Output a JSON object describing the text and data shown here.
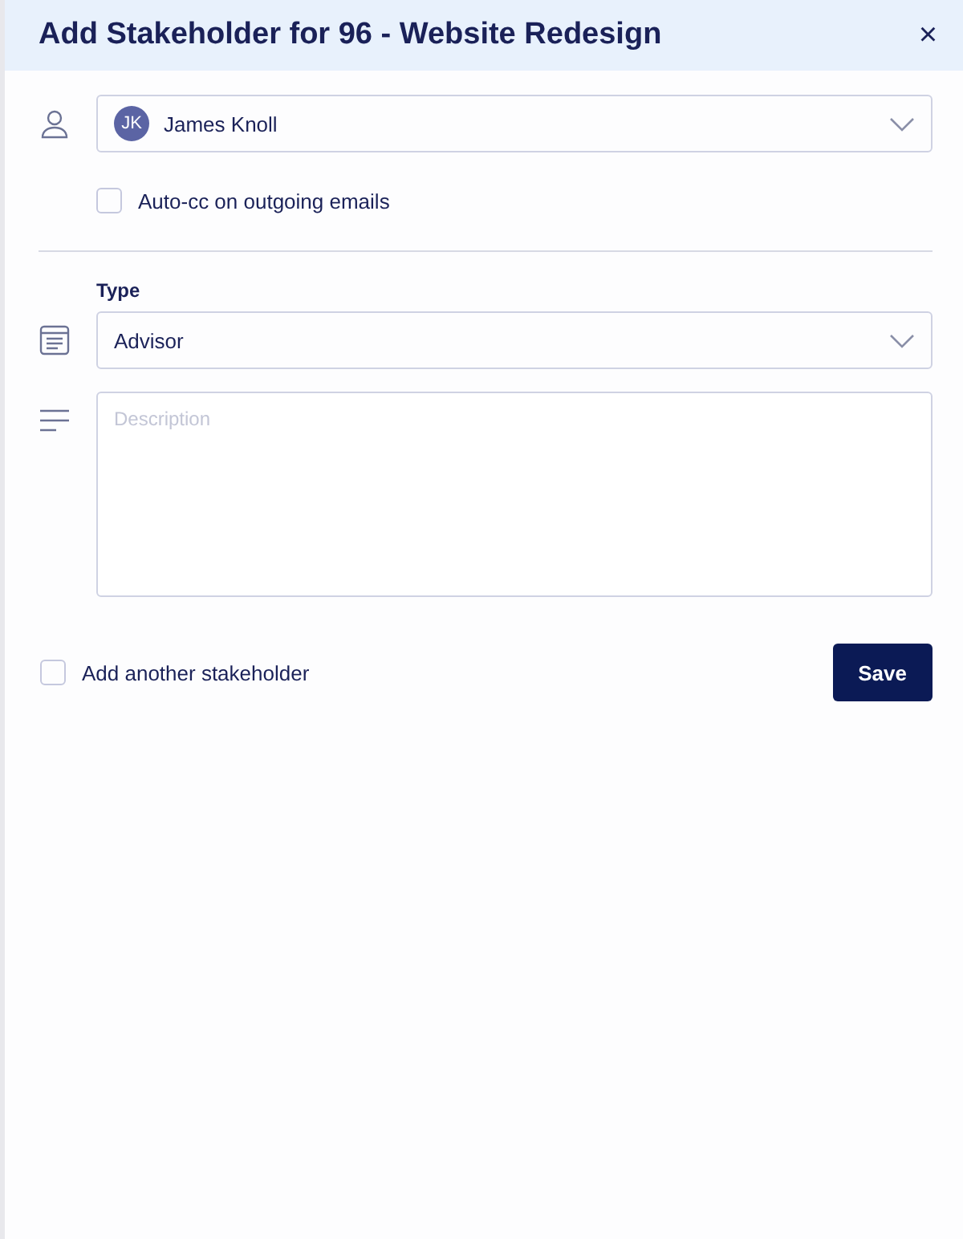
{
  "dialog": {
    "title": "Add Stakeholder for 96 - Website Redesign",
    "close": "×"
  },
  "contact": {
    "initials": "JK",
    "name": "James Knoll"
  },
  "auto_cc": {
    "label": "Auto-cc on outgoing emails",
    "checked": false
  },
  "type": {
    "label": "Type",
    "value": "Advisor"
  },
  "description": {
    "placeholder": "Description"
  },
  "add_another": {
    "label": "Add another stakeholder",
    "checked": false
  },
  "save": "Save"
}
